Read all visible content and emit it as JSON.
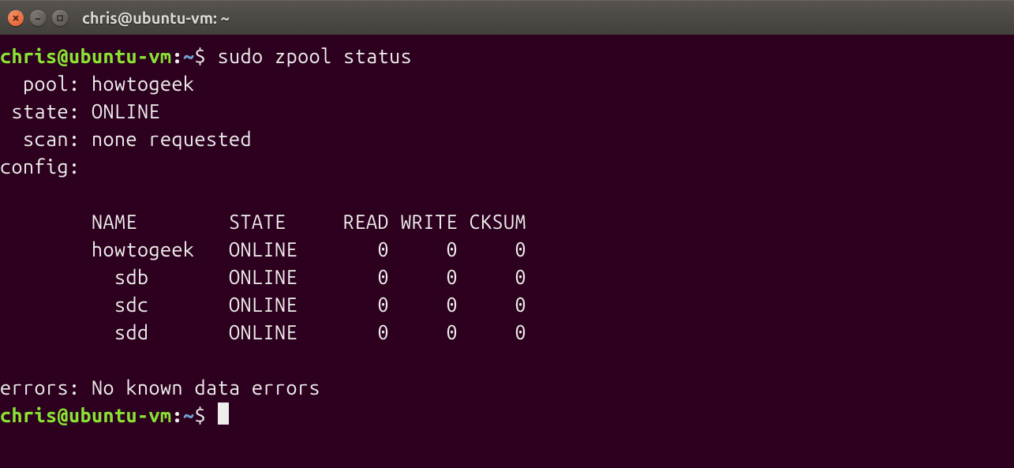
{
  "window": {
    "title": "chris@ubuntu-vm: ~"
  },
  "prompt": {
    "user_host": "chris@ubuntu-vm",
    "sep": ":",
    "path": "~",
    "symbol": "$"
  },
  "command": "sudo zpool status",
  "output": {
    "pool_label": "  pool:",
    "pool_value": "howtogeek",
    "state_label": " state:",
    "state_value": "ONLINE",
    "scan_label": "  scan:",
    "scan_value": "none requested",
    "config_label": "config:",
    "headers": {
      "name": "NAME",
      "state": "STATE",
      "read": "READ",
      "write": "WRITE",
      "cksum": "CKSUM"
    },
    "rows": [
      {
        "indent": "        ",
        "name": "howtogeek",
        "state": "ONLINE",
        "read": "0",
        "write": "0",
        "cksum": "0"
      },
      {
        "indent": "          ",
        "name": "sdb",
        "state": "ONLINE",
        "read": "0",
        "write": "0",
        "cksum": "0"
      },
      {
        "indent": "          ",
        "name": "sdc",
        "state": "ONLINE",
        "read": "0",
        "write": "0",
        "cksum": "0"
      },
      {
        "indent": "          ",
        "name": "sdd",
        "state": "ONLINE",
        "read": "0",
        "write": "0",
        "cksum": "0"
      }
    ],
    "errors_label": "errors:",
    "errors_value": "No known data errors"
  }
}
